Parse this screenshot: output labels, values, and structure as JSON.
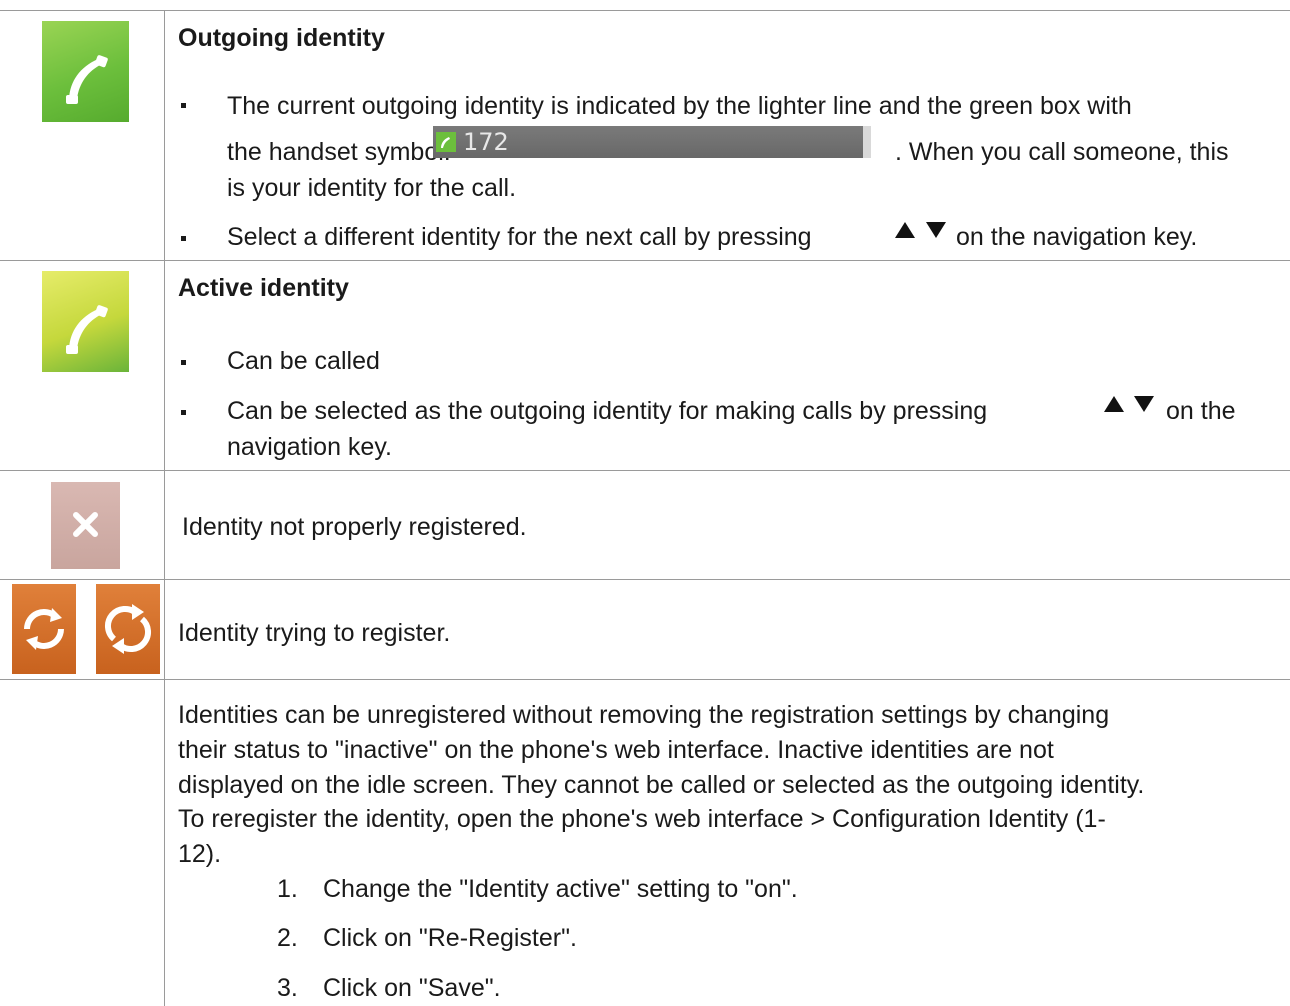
{
  "row1": {
    "heading": "Outgoing identity",
    "b1_line1": "The current outgoing identity is indicated by the lighter line and the green box with",
    "b1_line2_pre": "the handset symbol:",
    "status_number": "172",
    "b1_line2_post": ". When you call someone, this",
    "b1_line3": "is your identity for the call.",
    "b2_pre": "Select a different identity for the next call by pressing",
    "b2_post": "on the navigation key."
  },
  "row2": {
    "heading": "Active identity",
    "b1": "Can be called",
    "b2_pre": "Can be selected as the outgoing identity for making calls by pressing",
    "b2_post": "on the",
    "b2_line2": "navigation key."
  },
  "row3": {
    "text": "Identity not properly registered."
  },
  "row4": {
    "text": "Identity trying to register."
  },
  "row5": {
    "p_line1": "Identities can be unregistered without removing the registration settings by changing",
    "p_line2": "their status to \"inactive\" on the phone's web interface.  Inactive identities are not",
    "p_line3": "displayed on the idle screen.  They cannot be called or selected as the outgoing identity.",
    "p_line4": "To reregister the identity, open the phone's web interface  >  Configuration Identity (1-",
    "p_line5": "12).",
    "steps": [
      {
        "n": "1.",
        "text": "Change the \"Identity active\" setting to \"on\"."
      },
      {
        "n": "2.",
        "text": "Click on \"Re-Register\"."
      },
      {
        "n": "3.",
        "text": "Click on \"Save\"."
      }
    ]
  },
  "icons": {
    "row1": "outgoing-handset-icon",
    "row2": "active-handset-icon",
    "row3": "not-registered-x-icon",
    "row4a": "registering-arrows-icon",
    "row4b": "registering-arrows-icon"
  }
}
